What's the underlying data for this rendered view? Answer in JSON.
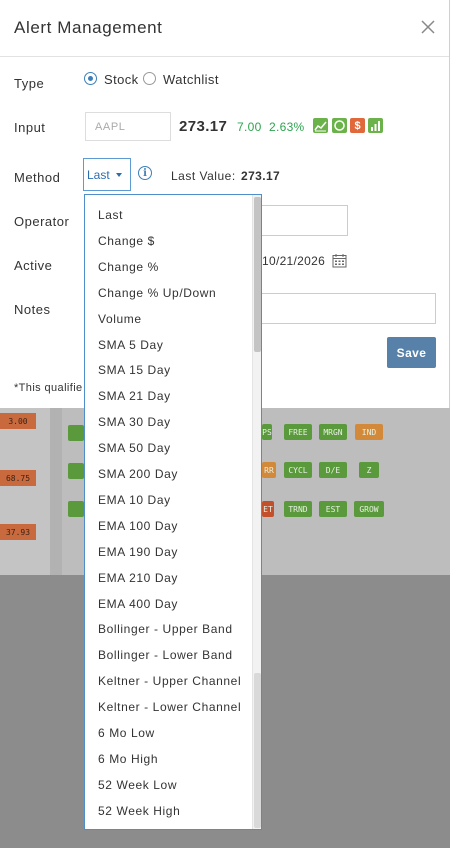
{
  "modal": {
    "title": "Alert Management",
    "type_label": "Type",
    "type_options": [
      "Stock",
      "Watchlist"
    ],
    "input_label": "Input",
    "input_placeholder": "AAPL",
    "price": "273.17",
    "change": "7.00",
    "change_pct": "2.63%",
    "method_label": "Method",
    "method_value": "Last",
    "last_value_label": "Last Value:",
    "last_value": "273.17",
    "operator_label": "Operator",
    "active_label": "Active",
    "active_date": "10/21/2026",
    "notes_label": "Notes",
    "save_label": "Save",
    "footnote": "*This qualifie"
  },
  "indicator_icons": [
    {
      "name": "chart-icon",
      "color": "#6cb24a"
    },
    {
      "name": "circle-icon",
      "color": "#6cb24a"
    },
    {
      "name": "dollar-icon",
      "color": "#e0683a"
    },
    {
      "name": "bars-icon",
      "color": "#6cb24a"
    }
  ],
  "dropdown": {
    "items": [
      "Last",
      "Change $",
      "Change %",
      "Change % Up/Down",
      "Volume",
      "SMA 5 Day",
      "SMA 15 Day",
      "SMA 21 Day",
      "SMA 30 Day",
      "SMA 50 Day",
      "SMA 200 Day",
      "EMA 10 Day",
      "EMA 100 Day",
      "EMA 190 Day",
      "EMA 210 Day",
      "EMA 400 Day",
      "Bollinger - Upper Band",
      "Bollinger - Lower Band",
      "Keltner - Upper Channel",
      "Keltner - Lower Channel",
      "6 Mo Low",
      "6 Mo High",
      "52 Week Low",
      "52 Week High"
    ]
  },
  "background": {
    "prices": [
      "3.00",
      "68.75",
      "37.93"
    ],
    "badges_row1": [
      "PS",
      "FREE",
      "MRGN",
      "IND"
    ],
    "badges_row2": [
      "RR",
      "CYCL",
      "D/E",
      "Z"
    ],
    "badges_row3": [
      "ET",
      "TRND",
      "EST",
      "GROW"
    ]
  },
  "colors": {
    "accent": "#3d7fb8",
    "positive": "#2ea44f",
    "save_button": "#5781a8"
  }
}
